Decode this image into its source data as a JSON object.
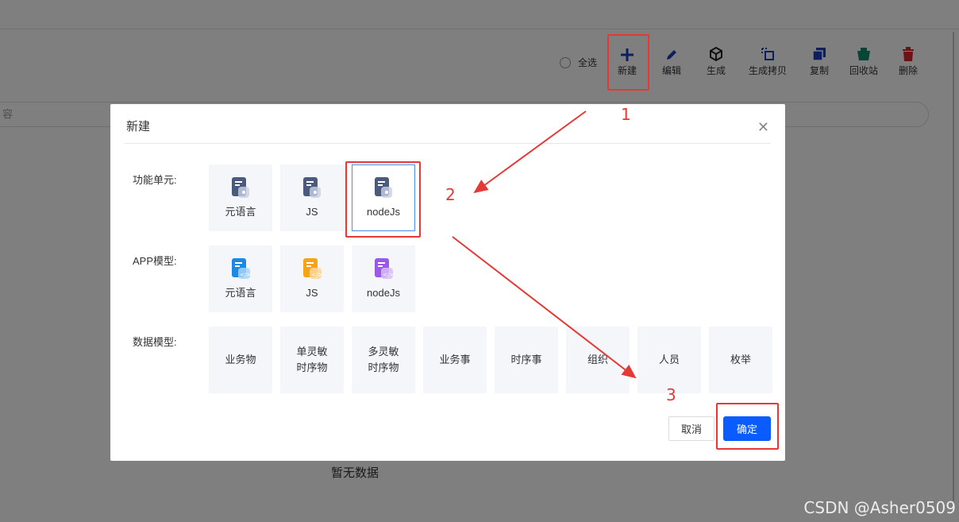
{
  "toolbar": {
    "select_all": "全选",
    "buttons": [
      {
        "label": "新建",
        "icon": "plus-icon"
      },
      {
        "label": "编辑",
        "icon": "pencil-icon"
      },
      {
        "label": "生成",
        "icon": "cube-icon"
      },
      {
        "label": "生成拷贝",
        "icon": "copy-generate-icon"
      },
      {
        "label": "复制",
        "icon": "duplicate-icon"
      },
      {
        "label": "回收站",
        "icon": "recycle-bin-icon"
      },
      {
        "label": "删除",
        "icon": "trash-icon"
      }
    ]
  },
  "search": {
    "placeholder_fragment": "容"
  },
  "empty_state": "暂无数据",
  "dialog": {
    "title": "新建",
    "close_icon": "close-icon",
    "sections": [
      {
        "label": "功能单元:",
        "items": [
          "元语言",
          "JS",
          "nodeJs"
        ],
        "selected": "nodeJs"
      },
      {
        "label": "APP模型:",
        "items": [
          "元语言",
          "JS",
          "nodeJs"
        ]
      },
      {
        "label": "数据模型:",
        "items": [
          "业务物",
          "单灵敏\n时序物",
          "多灵敏\n时序物",
          "业务事",
          "时序事",
          "组织",
          "人员",
          "枚举"
        ]
      }
    ],
    "cancel_label": "取消",
    "ok_label": "确定"
  },
  "annotations": {
    "step1": "1",
    "step2": "2",
    "step3": "3"
  },
  "watermark": "CSDN @Asher0509",
  "colors": {
    "primary": "#0b5cff",
    "annotation": "#e53935",
    "toolbar_blue": "#1a3fbf",
    "delete_red": "#d9262a",
    "recycle_green": "#0f8a6b"
  }
}
